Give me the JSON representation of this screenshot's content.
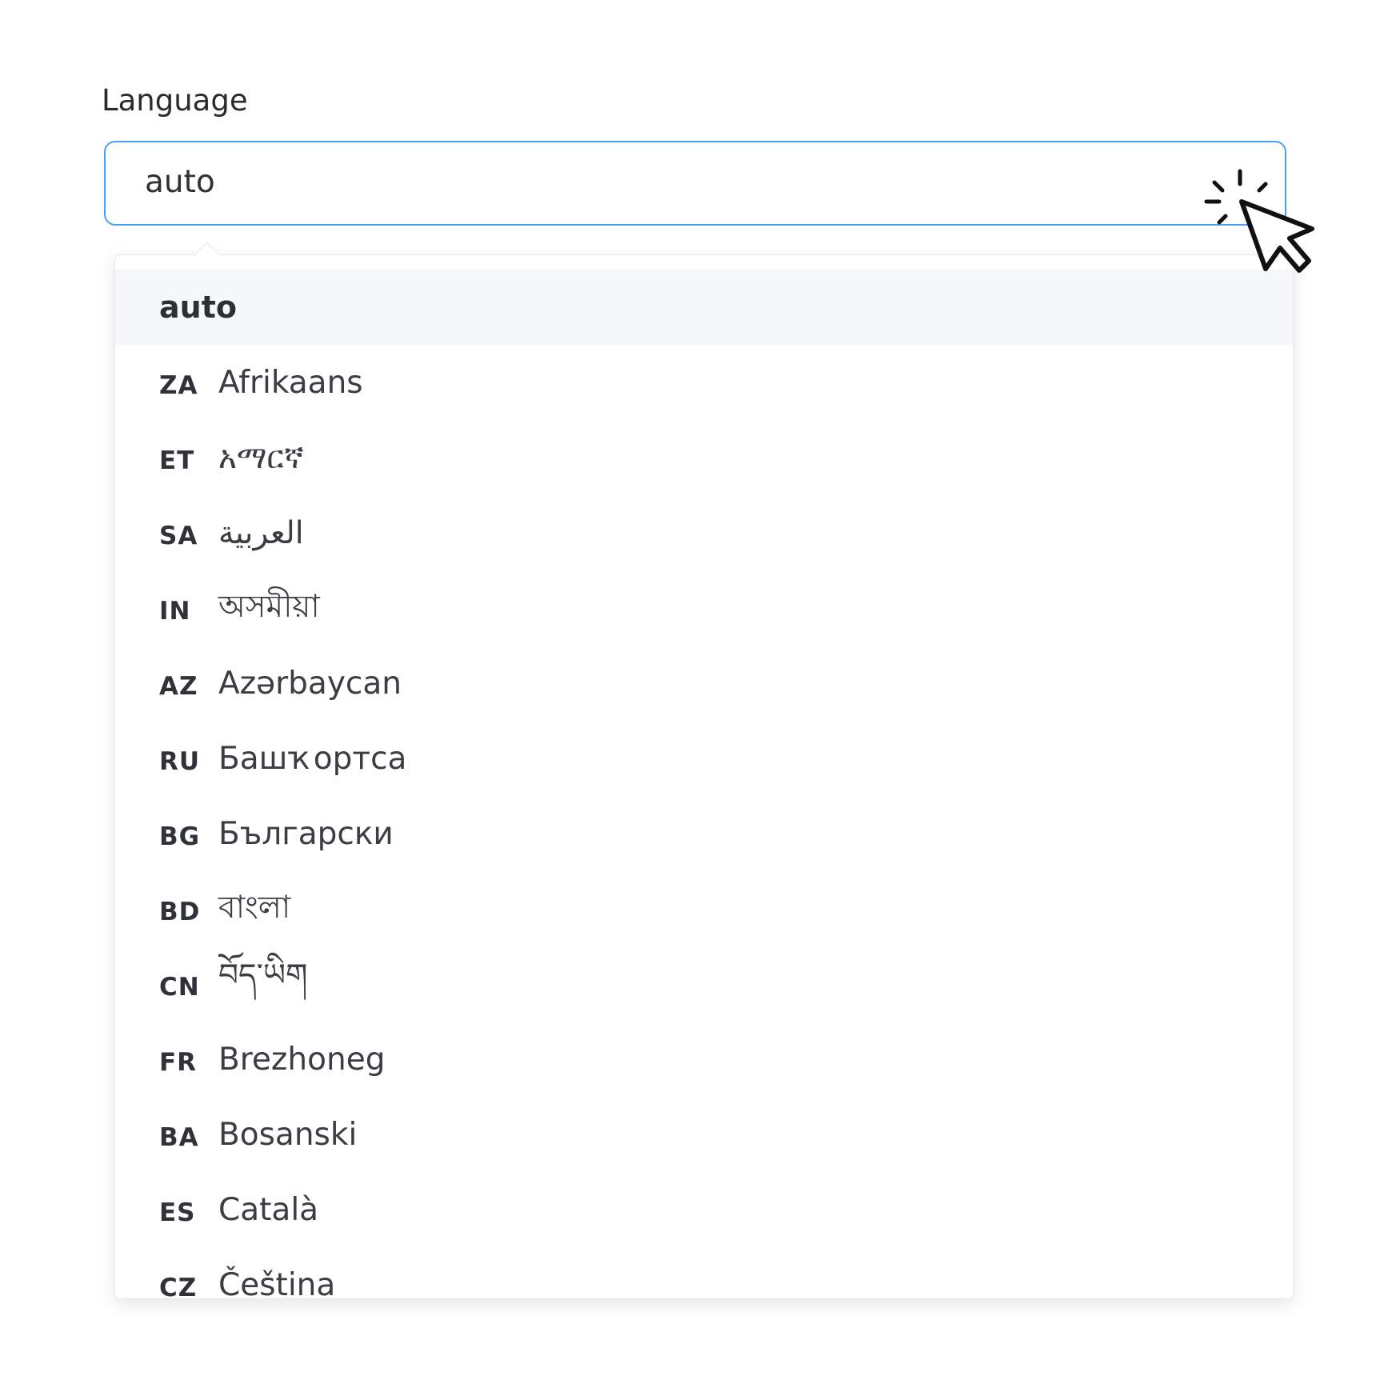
{
  "field": {
    "label": "Language",
    "value": "auto"
  },
  "dropdown": {
    "options": [
      {
        "code": "",
        "name": "auto",
        "selected": true
      },
      {
        "code": "ZA",
        "name": "Afrikaans"
      },
      {
        "code": "ET",
        "name": "አማርኛ"
      },
      {
        "code": "SA",
        "name": "العربية"
      },
      {
        "code": "IN",
        "name": "অসমীয়া"
      },
      {
        "code": "AZ",
        "name": "Azərbaycan"
      },
      {
        "code": "RU",
        "name": "Башҡортса"
      },
      {
        "code": "BG",
        "name": "Български"
      },
      {
        "code": "BD",
        "name": "বাংলা"
      },
      {
        "code": "CN",
        "name": "བོད་ཡིག"
      },
      {
        "code": "FR",
        "name": "Brezhoneg"
      },
      {
        "code": "BA",
        "name": "Bosanski"
      },
      {
        "code": "ES",
        "name": "Català"
      },
      {
        "code": "CZ",
        "name": "Čeština"
      }
    ]
  },
  "colors": {
    "input_border": "#4a9ef5",
    "selected_bg": "#f5f7fa"
  },
  "icons": {
    "cursor": "click-cursor-icon"
  }
}
